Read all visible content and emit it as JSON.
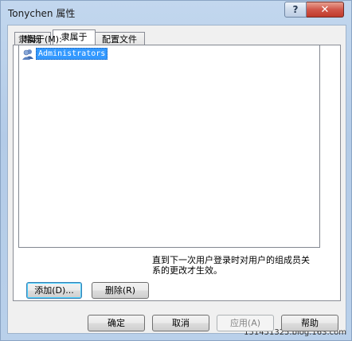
{
  "window": {
    "title": "Tonychen 属性",
    "help_glyph": "?",
    "close_glyph": "✕"
  },
  "tabs": [
    {
      "label": "常规",
      "active": false
    },
    {
      "label": "隶属于",
      "active": true
    },
    {
      "label": "配置文件",
      "active": false
    }
  ],
  "member_of": {
    "label": "隶属于(M):",
    "items": [
      "Administrators"
    ]
  },
  "buttons": {
    "add": "添加(D)...",
    "remove": "删除(R)",
    "ok": "确定",
    "cancel": "取消",
    "apply": "应用(A)",
    "help": "帮助"
  },
  "note": "直到下一次用户登录时对用户的组成员关系的更改才生效。",
  "watermark": "151451325.blog.163.com"
}
